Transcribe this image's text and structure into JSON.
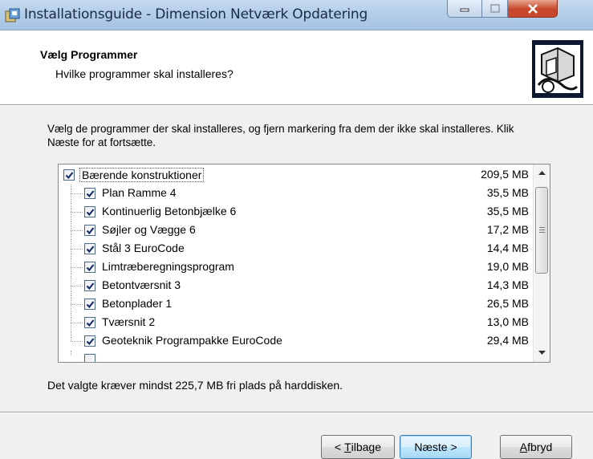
{
  "window": {
    "title": "Installationsguide - Dimension Netværk Opdatering"
  },
  "header": {
    "title": "Vælg Programmer",
    "subtitle": "Hvilke programmer skal installeres?"
  },
  "description": "Vælg de programmer der skal installeres, og fjern markering fra dem der ikke skal installeres. Klik Næste for at fortsætte.",
  "components": [
    {
      "label": "Bærende konstruktioner",
      "size": "209,5 MB",
      "checked": true,
      "level": 0
    },
    {
      "label": "Plan Ramme 4",
      "size": "35,5 MB",
      "checked": true,
      "level": 1
    },
    {
      "label": "Kontinuerlig Betonbjælke 6",
      "size": "35,5 MB",
      "checked": true,
      "level": 1
    },
    {
      "label": "Søjler og Vægge 6",
      "size": "17,2 MB",
      "checked": true,
      "level": 1
    },
    {
      "label": "Stål 3 EuroCode",
      "size": "14,4 MB",
      "checked": true,
      "level": 1
    },
    {
      "label": "Limtræberegningsprogram",
      "size": "19,0 MB",
      "checked": true,
      "level": 1
    },
    {
      "label": "Betontværsnit 3",
      "size": "14,3 MB",
      "checked": true,
      "level": 1
    },
    {
      "label": "Betonplader 1",
      "size": "26,5 MB",
      "checked": true,
      "level": 1
    },
    {
      "label": "Tværsnit 2",
      "size": "13,0 MB",
      "checked": true,
      "level": 1
    },
    {
      "label": "Geoteknik Programpakke EuroCode",
      "size": "29,4 MB",
      "checked": true,
      "level": 1
    }
  ],
  "space_required": "Det valgte kræver mindst 225,7 MB fri plads på harddisken.",
  "buttons": {
    "back_prefix": "< ",
    "back_mnemonic": "T",
    "back_rest": "ilbage",
    "next": "Næste >",
    "cancel_mnemonic": "A",
    "cancel_rest": "fbryd"
  },
  "icons": {
    "app": "installer-icon",
    "logo": "computer-setup-icon",
    "check": "checkmark-icon"
  },
  "colors": {
    "titlebar": "#b3cde8",
    "close_button": "#c7452b",
    "dialog_background": "#f0f0f0",
    "default_button": "#bee6fd"
  }
}
